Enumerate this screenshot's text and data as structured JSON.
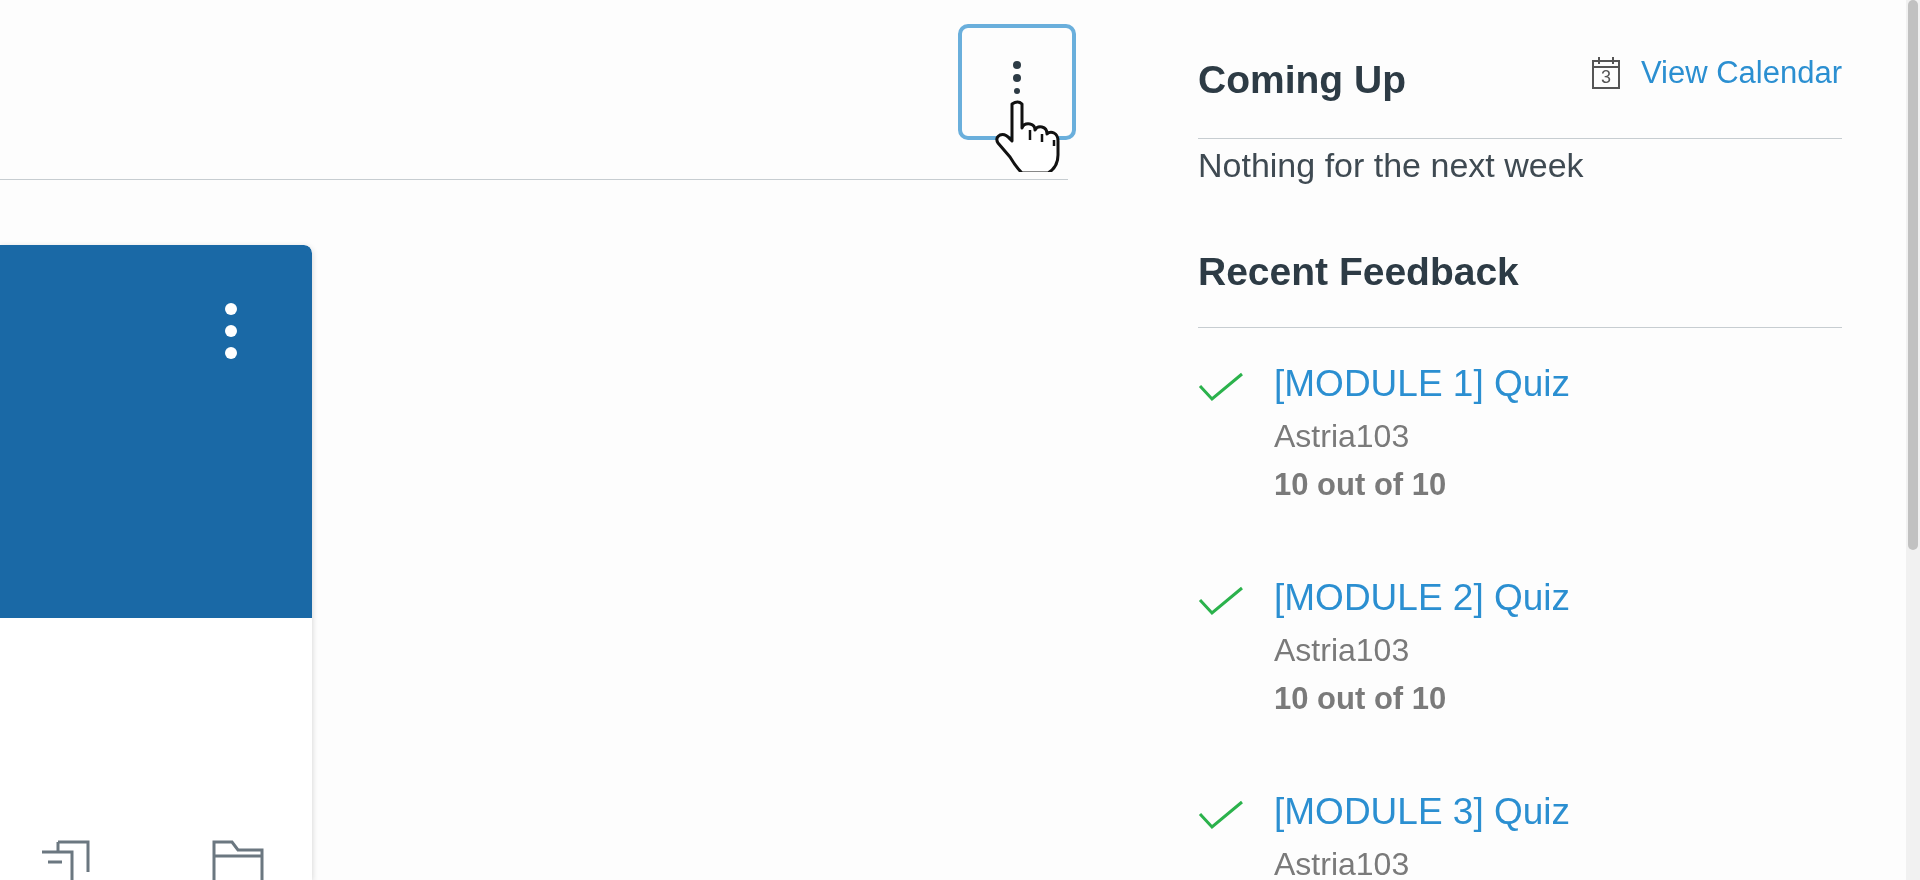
{
  "coming_up": {
    "title": "Coming Up",
    "calendar_day": "3",
    "link": "View Calendar",
    "empty_message": "Nothing for the next week"
  },
  "recent_feedback": {
    "title": "Recent Feedback",
    "items": [
      {
        "graded": true,
        "title": "[MODULE 1] Quiz",
        "course": "Astria103",
        "score": "10 out of 10"
      },
      {
        "graded": true,
        "title": "[MODULE 2] Quiz",
        "course": "Astria103",
        "score": "10 out of 10"
      },
      {
        "graded": true,
        "title": "[MODULE 3] Quiz",
        "course": "Astria103"
      }
    ]
  }
}
